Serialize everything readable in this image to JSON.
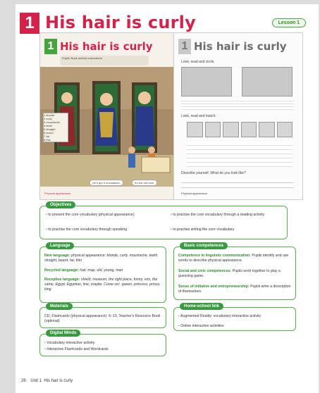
{
  "header": {
    "unit_number": "1",
    "title": "His hair is curly",
    "lesson": "Lesson 1"
  },
  "left_thumb": {
    "number": "1",
    "title": "His hair is curly",
    "instruction": "Pupils' Book activity instructions",
    "vocab": [
      "1 blonde",
      "2 curly",
      "3 moustache",
      "4 teeth",
      "5 straight",
      "6 beard",
      "7 fat",
      "8 thin"
    ],
    "speech1": "He's got a moustache.",
    "speech2": "It's the old man.",
    "footer": "Physical appearance"
  },
  "right_thumb": {
    "number": "1",
    "title": "His hair is curly",
    "act1": "Look, read and circle.",
    "act2": "Look, read and match.",
    "act3": "Describe yourself. What do you look like?",
    "footer": "Physical appearance"
  },
  "objectives": {
    "tag": "Objectives",
    "items": [
      "to present the core vocabulary (physical appearance)",
      "to practise the core vocabulary through speaking",
      "to practise the core vocabulary through a reading activity",
      "to practise writing the core vocabulary"
    ]
  },
  "language": {
    "tag": "Language",
    "new_label": "New language:",
    "new_text": "physical appearance: blonde, curly, moustache, teeth, straight, beard, fat, thin",
    "recycled_label": "Recycled language:",
    "recycled_text": "hair, map, old, young, man",
    "receptive_label": "Receptive language:",
    "receptive_text": "shield, museum, the right place, funny, son, the same, Egypt, Egyptian, line, maybe, Come on!, queen, princess, prince, king"
  },
  "basic": {
    "tag": "Basic competences",
    "c1_label": "Competence in linguistic communication:",
    "c1_text": "Pupils identify and use words to describe physical appearance.",
    "c2_label": "Social and civic competences:",
    "c2_text": "Pupils work together to play a guessing game.",
    "c3_label": "Sense of initiative and entrepreneurship:",
    "c3_text": "Pupils write a description of themselves."
  },
  "materials": {
    "tag": "Materials",
    "text": "CD, Flashcards (physical appearance): 6–13, Teacher's Resource Book (optional)"
  },
  "home": {
    "tag": "Home-school link",
    "items": [
      "Augmented Reality: vocabulary interactive activity",
      "Online interactive activities"
    ]
  },
  "digital": {
    "tag": "Digital Minds",
    "items": [
      "Vocabulary interactive activity",
      "Interactive Flashcards and Wordcards"
    ]
  },
  "footer": {
    "page": "26",
    "unit": "Unit 1",
    "title": "His hair is curly"
  },
  "colors": {
    "accent_red": "#d3234b",
    "accent_green": "#46a43f"
  }
}
